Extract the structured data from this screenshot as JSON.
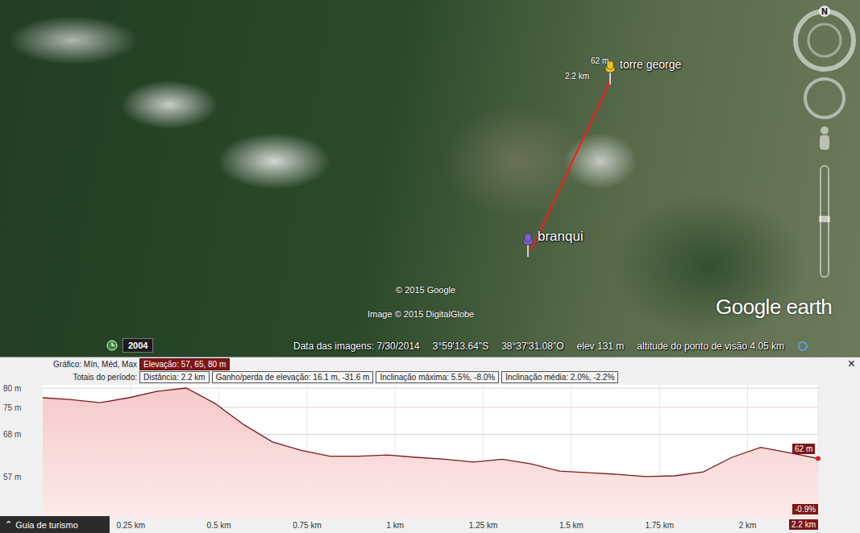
{
  "map": {
    "placemarks": [
      {
        "name": "torre george",
        "color": "#f2c21b"
      },
      {
        "name": "branqui",
        "color": "#7b5fd0"
      }
    ],
    "path": {
      "distance_label": "2.2 km",
      "elevation_label": "62 m"
    },
    "copyrights": [
      "© 2015 Google",
      "Image © 2015 DigitalGlobe"
    ],
    "logo": "Google earth",
    "time_badge": "2004",
    "compass": {
      "north": "N"
    }
  },
  "status_bar": {
    "imagery_date": "Data das imagens: 7/30/2014",
    "latitude": "3°59'13.64\"S",
    "longitude": "38°37'31.08\"O",
    "elevation": "elev 131 m",
    "eye_altitude": "altitude do ponto de visão 4.05 km"
  },
  "profile": {
    "header": {
      "label": "Gráfico: Mín, Méd, Max",
      "value": "Elevação: 57, 65, 80 m"
    },
    "totals": {
      "label": "Totais do período:",
      "items": [
        "Distância: 2.2 km",
        "Ganho/perda de elevação: 16.1 m, -31.6 m",
        "Inclinação máxima: 5.5%, -8.0%",
        "Inclinação média: 2.0%, -2.2%"
      ]
    },
    "close": "×",
    "y_ticks": [
      "80 m",
      "75 m",
      "68 m",
      "57 m"
    ],
    "x_ticks": [
      {
        "label": "0.25 km",
        "selected": false
      },
      {
        "label": "0.5 km",
        "selected": false
      },
      {
        "label": "0.75 km",
        "selected": false
      },
      {
        "label": "1 km",
        "selected": false
      },
      {
        "label": "1.25 km",
        "selected": false
      },
      {
        "label": "1.5 km",
        "selected": false
      },
      {
        "label": "1.75 km",
        "selected": false
      },
      {
        "label": "2 km",
        "selected": false
      },
      {
        "label": "2.2 km",
        "selected": true
      }
    ],
    "series": [
      {
        "name": "Elevação",
        "values": [
          77.5,
          77,
          76.2,
          77.5,
          79.2,
          80,
          76,
          70.5,
          66,
          63.8,
          62.3,
          62.3,
          62.6,
          62,
          61.5,
          60.8,
          61.5,
          60.3,
          58.4,
          58,
          57.6,
          57,
          57.2,
          58.2,
          62,
          64.6,
          63.2,
          61.7
        ]
      }
    ],
    "cursor": {
      "elevation": "62 m",
      "slope": "-0.9%"
    }
  },
  "tour_guide": {
    "icon": "⌃",
    "label": "Guia de turismo"
  }
}
